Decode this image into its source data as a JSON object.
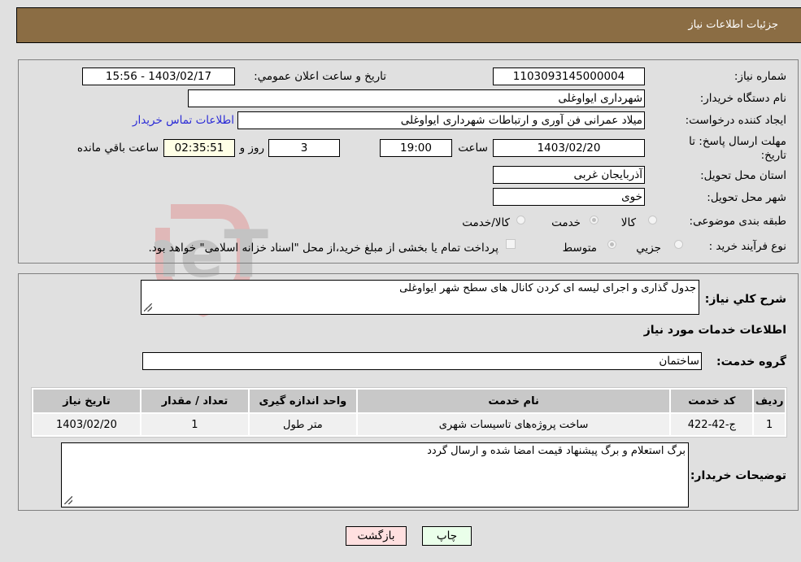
{
  "header": {
    "title": "جزئیات اطلاعات نیاز"
  },
  "form": {
    "need_number": {
      "label": "شماره نیاز:",
      "value": "1103093145000004"
    },
    "announce_datetime": {
      "label": "تاريخ و ساعت اعلان عمومي:",
      "value": "1403/02/17 - 15:56"
    },
    "buyer_org": {
      "label": "نام دستگاه خريدار:",
      "value": "شهرداری ایواوغلی"
    },
    "requester": {
      "label": "ايجاد کننده درخواست:",
      "value": "میلاد عمرانی فن آوری و ارتباطات شهرداری ایواوغلی"
    },
    "buyer_contact_link": "اطلاعات تماس خريدار",
    "deadline": {
      "label": "مهلت ارسال پاسخ: تا تاريخ:",
      "date": "1403/02/20",
      "time_label": "ساعت",
      "time": "19:00",
      "days": "3",
      "days_label": "روز و",
      "remaining": "02:35:51",
      "remaining_label": "ساعت باقي مانده"
    },
    "province": {
      "label": "استان محل تحويل:",
      "value": "آذربایجان غربی"
    },
    "city": {
      "label": "شهر محل تحويل:",
      "value": "خوی"
    },
    "category": {
      "label": "طبقه بندی موضوعی:",
      "options": [
        {
          "label": "کالا",
          "checked": false
        },
        {
          "label": "خدمت",
          "checked": true
        },
        {
          "label": "کالا/خدمت",
          "checked": false
        }
      ]
    },
    "purchase_type": {
      "label": "نوع فرآيند خريد :",
      "options": [
        {
          "label": "جزيي",
          "checked": false
        },
        {
          "label": "متوسط",
          "checked": true
        }
      ],
      "treasury_checkbox_label": "پرداخت تمام يا بخشی از مبلغ خريد،از محل \"اسناد خزانه اسلامی\" خواهد بود.",
      "treasury_checked": false
    }
  },
  "details": {
    "description_label": "شرح کلي نياز:",
    "description": "جدول گذاری و اجرای لیسه ای کردن کانال های سطح شهر ایواوغلی",
    "services_heading": "اطلاعات خدمات مورد نياز",
    "service_group_label": "گروه خدمت:",
    "service_group": "ساختمان",
    "table": {
      "headers": [
        "رديف",
        "کد خدمت",
        "نام خدمت",
        "واحد اندازه گيری",
        "تعداد / مقدار",
        "تاريخ نياز"
      ],
      "rows": [
        [
          "1",
          "ج-42-422",
          "ساخت پروژه‌های تاسیسات شهری",
          "متر طول",
          "1",
          "1403/02/20"
        ]
      ]
    },
    "buyer_notes_label": "توضيحات خريدار:",
    "buyer_notes": "برگ استعلام و برگ پیشنهاد قیمت امضا شده و ارسال گردد"
  },
  "buttons": {
    "print": "چاپ",
    "back": "بازگشت"
  },
  "colors": {
    "header_bg": "#8b6d44",
    "print_bg": "#eaffea",
    "back_bg": "#ffe0e0",
    "link": "#2b2bd6"
  }
}
